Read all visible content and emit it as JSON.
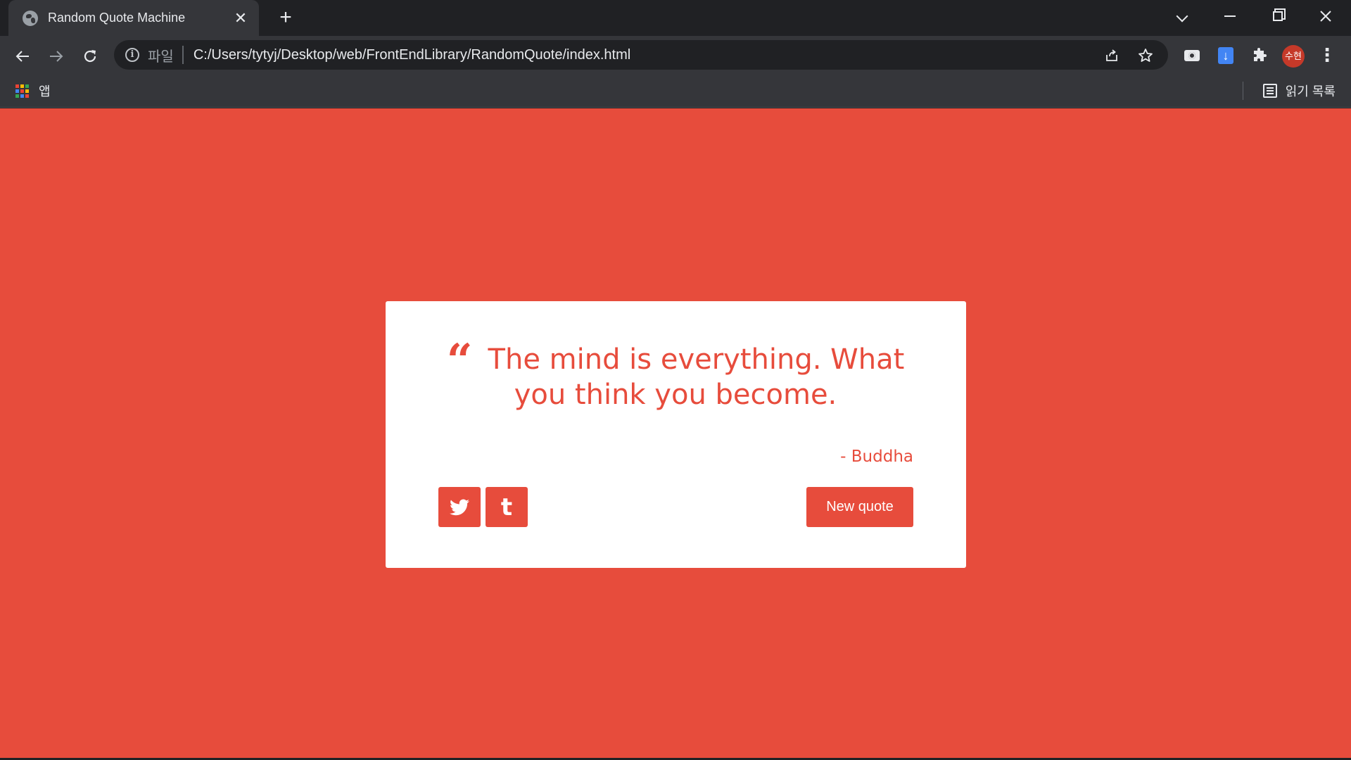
{
  "browser": {
    "tab_title": "Random Quote Machine",
    "tab_close_glyph": "✕",
    "new_tab_glyph": "+",
    "scheme_label": "파일",
    "url": "C:/Users/tytyj/Desktop/web/FrontEndLibrary/RandomQuote/index.html",
    "profile_initials": "수현",
    "bookmarks": {
      "apps_label": "앱",
      "reading_list_label": "읽기 목록"
    }
  },
  "page": {
    "background_color": "#e74c3c",
    "accent_color": "#e74c3c",
    "quote_text": "The mind is everything. What you think you become.",
    "quote_author": "- Buddha",
    "new_quote_label": "New quote",
    "share_icons": [
      "twitter-icon",
      "tumblr-icon"
    ]
  },
  "colors": {
    "tab_bar": "#202124",
    "toolbar": "#35363a",
    "omnibox": "#202124",
    "text": "#e8eaed",
    "profile_avatar": "#c53929",
    "download_icon": "#4285f4"
  }
}
